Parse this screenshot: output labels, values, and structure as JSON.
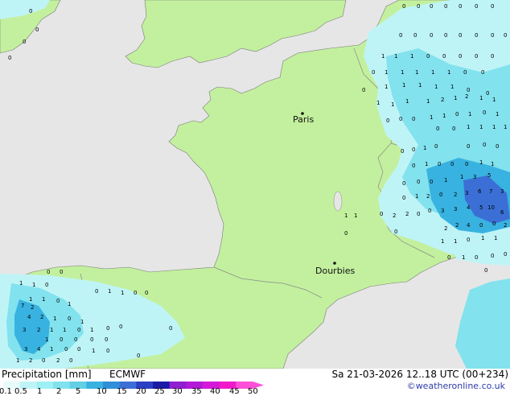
{
  "map": {
    "colors": {
      "sea": "#e6e6e6",
      "land": "#c3f09e",
      "border": "#7a7a7a",
      "precip_light": "#bff4f7",
      "precip_mid": "#82e2ee",
      "precip_high": "#38b2e0",
      "precip_heavy": "#3b6fd6"
    },
    "cities": [
      {
        "name": "Paris"
      },
      {
        "name": "Dourbies"
      }
    ]
  },
  "footer": {
    "title": "Precipitation [mm]",
    "model": "ECMWF",
    "datetime": "Sa 21-03-2026 12..18 UTC (00+234)",
    "copyright": "©weatheronline.co.uk",
    "scale_labels": [
      "0.1",
      "0.5",
      "1",
      "2",
      "5",
      "10",
      "15",
      "20",
      "25",
      "30",
      "35",
      "40",
      "45",
      "50"
    ],
    "scale_colors": [
      "#e8fbfb",
      "#bff4f7",
      "#9ff0f5",
      "#82e2ee",
      "#62cfe6",
      "#38b2e0",
      "#2f8fd8",
      "#3b6fd6",
      "#2a3fc4",
      "#1b1aa8",
      "#8f1fd0",
      "#b21ad8",
      "#d41ad8",
      "#f11acb",
      "#ff4fd8"
    ]
  }
}
